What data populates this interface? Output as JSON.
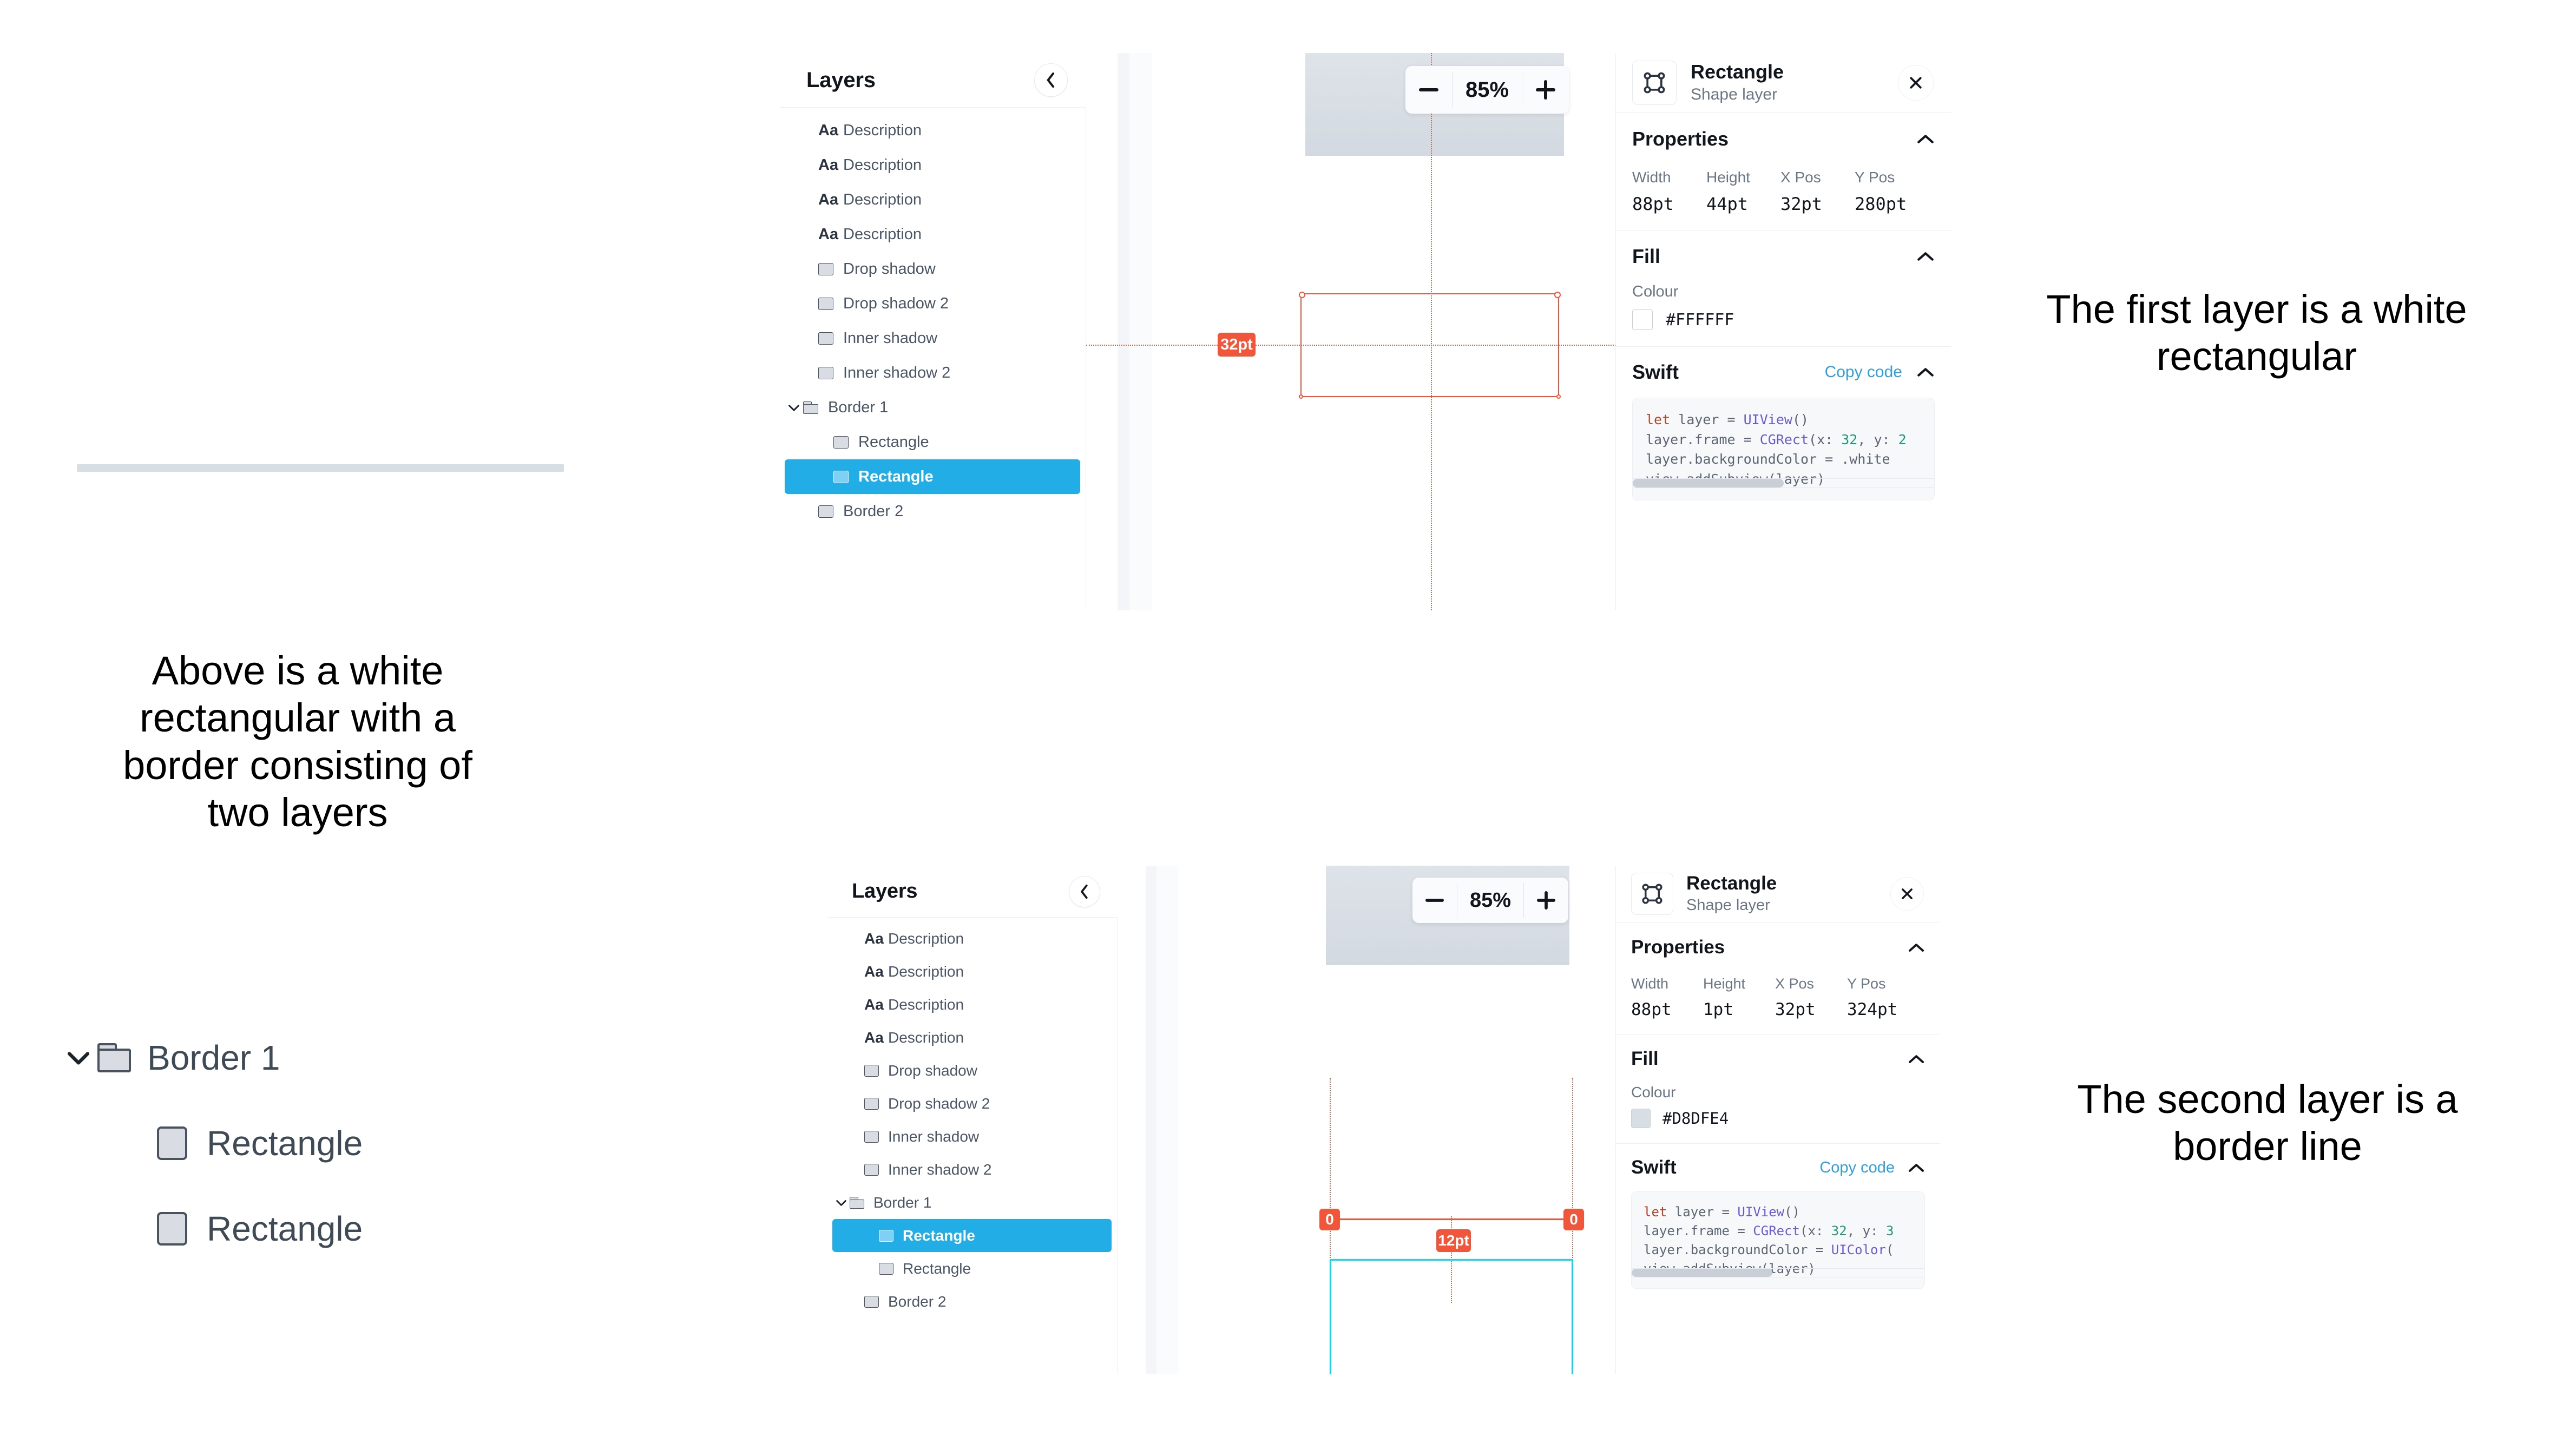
{
  "annotations": {
    "top_right": "The first layer is a white rectangular",
    "left_middle": "Above is a white rectangular with a border consisting of two layers",
    "bottom_right": "The second layer is a border line"
  },
  "big_tree": {
    "folder": {
      "label": "Border 1",
      "chevron": "chevron-down"
    },
    "children": [
      {
        "label": "Rectangle"
      },
      {
        "label": "Rectangle"
      }
    ]
  },
  "panel_top": {
    "layers": {
      "title": "Layers",
      "collapse_icon": "chevron-left",
      "items": [
        {
          "label": "Description",
          "icon": "text-icon",
          "depth": 1,
          "selected": false
        },
        {
          "label": "Description",
          "icon": "text-icon",
          "depth": 1,
          "selected": false
        },
        {
          "label": "Description",
          "icon": "text-icon",
          "depth": 1,
          "selected": false
        },
        {
          "label": "Description",
          "icon": "text-icon",
          "depth": 1,
          "selected": false
        },
        {
          "label": "Drop shadow",
          "icon": "shape-icon",
          "depth": 1,
          "selected": false
        },
        {
          "label": "Drop shadow 2",
          "icon": "shape-icon",
          "depth": 1,
          "selected": false
        },
        {
          "label": "Inner shadow",
          "icon": "shape-icon",
          "depth": 1,
          "selected": false
        },
        {
          "label": "Inner shadow 2",
          "icon": "shape-icon",
          "depth": 1,
          "selected": false
        },
        {
          "label": "Border 1",
          "icon": "folder-icon",
          "depth": 0,
          "selected": false,
          "chevron": "chevron-down"
        },
        {
          "label": "Rectangle",
          "icon": "shape-icon",
          "depth": 2,
          "selected": false
        },
        {
          "label": "Rectangle",
          "icon": "shape-icon",
          "depth": 2,
          "selected": true
        },
        {
          "label": "Border 2",
          "icon": "shape-icon",
          "depth": 1,
          "selected": false
        }
      ]
    },
    "canvas": {
      "zoom_level": "85%",
      "zoom_out_icon": "minus-icon",
      "zoom_in_icon": "plus-icon",
      "link_icon": "link-icon",
      "measure_badge": "32pt"
    },
    "inspector": {
      "name": "Rectangle",
      "subtitle": "Shape layer",
      "thumb_icon": "shape-bounds-icon",
      "close_icon": "close-icon",
      "properties": {
        "title": "Properties",
        "caret": "chevron-up",
        "fields": [
          {
            "key": "Width",
            "value": "88pt"
          },
          {
            "key": "Height",
            "value": "44pt"
          },
          {
            "key": "X Pos",
            "value": "32pt"
          },
          {
            "key": "Y Pos",
            "value": "280pt"
          }
        ]
      },
      "fill": {
        "title": "Fill",
        "caret": "chevron-up",
        "colour_label": "Colour",
        "hex": "#FFFFFF",
        "swatch_color": "#FFFFFF"
      },
      "swift": {
        "title": "Swift",
        "copy_label": "Copy code",
        "caret": "chevron-up",
        "code_lines": [
          "let layer = UIView()",
          "layer.frame = CGRect(x: 32, y: 2",
          "layer.backgroundColor = .white",
          "view.addSubview(layer)"
        ]
      }
    }
  },
  "panel_bottom": {
    "layers": {
      "title": "Layers",
      "collapse_icon": "chevron-left",
      "items": [
        {
          "label": "Description",
          "icon": "text-icon",
          "depth": 1,
          "selected": false
        },
        {
          "label": "Description",
          "icon": "text-icon",
          "depth": 1,
          "selected": false
        },
        {
          "label": "Description",
          "icon": "text-icon",
          "depth": 1,
          "selected": false
        },
        {
          "label": "Description",
          "icon": "text-icon",
          "depth": 1,
          "selected": false
        },
        {
          "label": "Drop shadow",
          "icon": "shape-icon",
          "depth": 1,
          "selected": false
        },
        {
          "label": "Drop shadow 2",
          "icon": "shape-icon",
          "depth": 1,
          "selected": false
        },
        {
          "label": "Inner shadow",
          "icon": "shape-icon",
          "depth": 1,
          "selected": false
        },
        {
          "label": "Inner shadow 2",
          "icon": "shape-icon",
          "depth": 1,
          "selected": false
        },
        {
          "label": "Border 1",
          "icon": "folder-icon",
          "depth": 0,
          "selected": false,
          "chevron": "chevron-down"
        },
        {
          "label": "Rectangle",
          "icon": "shape-icon",
          "depth": 2,
          "selected": true
        },
        {
          "label": "Rectangle",
          "icon": "shape-icon",
          "depth": 2,
          "selected": false
        },
        {
          "label": "Border 2",
          "icon": "shape-icon",
          "depth": 1,
          "selected": false
        }
      ]
    },
    "canvas": {
      "zoom_level": "85%",
      "zoom_out_icon": "minus-icon",
      "zoom_in_icon": "plus-icon",
      "link_icon": "link-icon",
      "measure_badge": "12pt",
      "endpoint_left": "0",
      "endpoint_right": "0"
    },
    "inspector": {
      "name": "Rectangle",
      "subtitle": "Shape layer",
      "thumb_icon": "shape-bounds-icon",
      "close_icon": "close-icon",
      "properties": {
        "title": "Properties",
        "caret": "chevron-up",
        "fields": [
          {
            "key": "Width",
            "value": "88pt"
          },
          {
            "key": "Height",
            "value": "1pt"
          },
          {
            "key": "X Pos",
            "value": "32pt"
          },
          {
            "key": "Y Pos",
            "value": "324pt"
          }
        ]
      },
      "fill": {
        "title": "Fill",
        "caret": "chevron-up",
        "colour_label": "Colour",
        "hex": "#D8DFE4",
        "swatch_color": "#D8DFE4"
      },
      "swift": {
        "title": "Swift",
        "copy_label": "Copy code",
        "caret": "chevron-up",
        "code_lines": [
          "let layer = UIView()",
          "layer.frame = CGRect(x: 32, y: 3",
          "layer.backgroundColor = UIColor(",
          "view.addSubview(layer)"
        ]
      }
    }
  },
  "colors": {
    "selection_blue": "#22ade6",
    "measure_orange": "#f2563a",
    "cyan_outline": "#19d4e8",
    "link_blue": "#2f9fe0",
    "border_line_grey": "#d8dfe4"
  }
}
